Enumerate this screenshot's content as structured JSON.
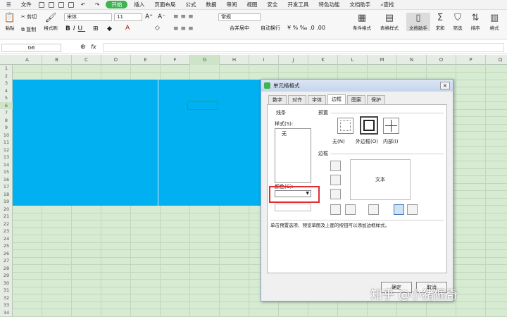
{
  "menubar": {
    "file": "文件",
    "start": "开始",
    "items": [
      "插入",
      "页面布局",
      "公式",
      "数据",
      "审阅",
      "视图",
      "安全",
      "开发工具",
      "特色功能",
      "文档助手"
    ],
    "search": "查找"
  },
  "ribbon": {
    "cut": "剪切",
    "paste": "粘贴",
    "copy": "复制",
    "format_painter": "格式刷",
    "font_name": "宋体",
    "font_size": "11",
    "number_format": "常规",
    "merge": "合并居中",
    "wrap": "自动换行",
    "conditional": "条件格式",
    "table_style": "表格样式",
    "doc_helper": "文档助手",
    "sum": "求和",
    "filter": "筛选",
    "sort": "排序",
    "format": "格式"
  },
  "formula_bar": {
    "cell_ref": "G6",
    "fx": "fx",
    "value": ""
  },
  "sheet": {
    "columns": [
      "A",
      "B",
      "C",
      "D",
      "E",
      "F",
      "G",
      "H",
      "I",
      "J",
      "K",
      "L",
      "M",
      "N",
      "O",
      "P",
      "Q"
    ],
    "rows": [
      "1",
      "2",
      "3",
      "4",
      "5",
      "6",
      "7",
      "8",
      "9",
      "10",
      "11",
      "12",
      "13",
      "14",
      "15",
      "16",
      "17",
      "18",
      "19",
      "20",
      "21",
      "22",
      "23",
      "24",
      "25",
      "26",
      "27",
      "28",
      "29",
      "30",
      "31",
      "32",
      "33",
      "34"
    ],
    "selected_column": "G",
    "selected_row": "6",
    "fill_color": "#00b0f0"
  },
  "dialog": {
    "title": "单元格格式",
    "close": "×",
    "tabs": [
      "数字",
      "对齐",
      "字体",
      "边框",
      "图案",
      "保护"
    ],
    "active_tab": "边框",
    "line_group": "线条",
    "style_label": "样式(S):",
    "style_selected": "无",
    "color_label": "颜色(C):",
    "presets_label": "预置",
    "preset_none": "无(N)",
    "preset_outline": "外边框(O)",
    "preset_inside": "内部(I)",
    "border_label": "边框",
    "preview_text": "文本",
    "hint": "单击预置选项、预览草图及上面的按钮可以添加边框样式。",
    "ok": "确定",
    "cancel": "取消"
  },
  "watermark": "知乎 @小猪佩奇"
}
